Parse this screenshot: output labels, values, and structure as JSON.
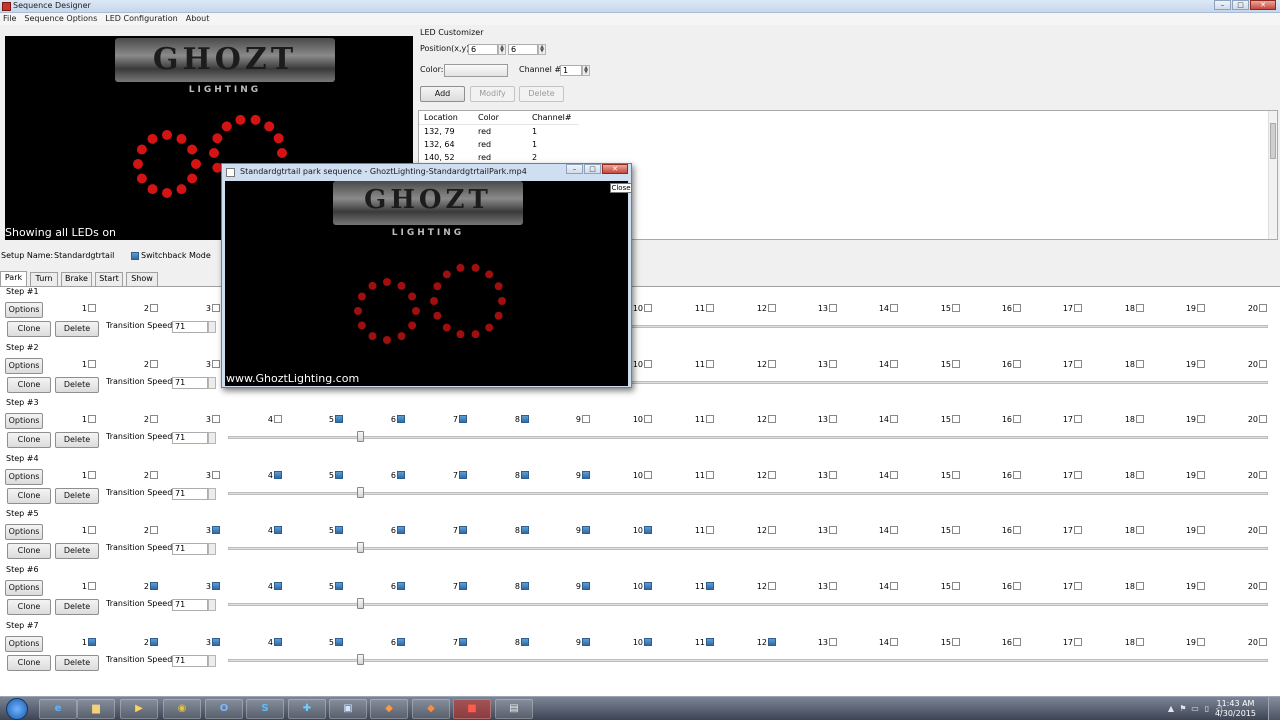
{
  "window": {
    "title": "Sequence Designer"
  },
  "menu": [
    "File",
    "Sequence Options",
    "LED Configuration",
    "About"
  ],
  "preview": {
    "logo_text": "GHOZT",
    "logo_sub": "LIGHTING",
    "status": "Showing all LEDs on"
  },
  "customizer": {
    "heading": "LED Customizer",
    "position_label": "Position(x,y):",
    "pos_x": "6",
    "pos_y": "6",
    "color_label": "Color:",
    "channel_label": "Channel #:",
    "channel": "1",
    "add": "Add",
    "modify": "Modify",
    "delete": "Delete"
  },
  "led_table": {
    "headers": [
      "Location",
      "Color",
      "Channel#"
    ],
    "rows": [
      [
        "132, 79",
        "red",
        "1"
      ],
      [
        "132, 64",
        "red",
        "1"
      ],
      [
        "140, 52",
        "red",
        "2"
      ]
    ]
  },
  "setup": {
    "name_label": "Setup Name:",
    "name_value": "Standardgtrtail",
    "switchback_label": "Switchback Mode",
    "switchback_checked": true
  },
  "tabs": [
    "Park",
    "Turn",
    "Brake",
    "Start",
    "Show"
  ],
  "step_labels": {
    "options": "Options",
    "clone": "Clone",
    "delete": "Delete",
    "transition": "Transition Speed:"
  },
  "steps": [
    {
      "title": "Step #1",
      "speed": "71",
      "on": []
    },
    {
      "title": "Step #2",
      "speed": "71",
      "on": []
    },
    {
      "title": "Step #3",
      "speed": "71",
      "on": [
        5,
        6,
        7,
        8
      ]
    },
    {
      "title": "Step #4",
      "speed": "71",
      "on": [
        4,
        5,
        6,
        7,
        8,
        9
      ]
    },
    {
      "title": "Step #5",
      "speed": "71",
      "on": [
        3,
        4,
        5,
        6,
        7,
        8,
        9,
        10
      ]
    },
    {
      "title": "Step #6",
      "speed": "71",
      "on": [
        2,
        3,
        4,
        5,
        6,
        7,
        8,
        9,
        10,
        11
      ]
    },
    {
      "title": "Step #7",
      "speed": "71",
      "on": [
        1,
        2,
        3,
        4,
        5,
        6,
        7,
        8,
        9,
        10,
        11,
        12
      ]
    }
  ],
  "led_numbers": [
    "1",
    "2",
    "3",
    "4",
    "5",
    "6",
    "7",
    "8",
    "9",
    "10",
    "11",
    "12",
    "13",
    "14",
    "15",
    "16",
    "17",
    "18",
    "19",
    "20"
  ],
  "video": {
    "title": "Standardgtrtail park sequence - GhoztLighting-StandardgtrtailPark.mp4",
    "url": "www.GhoztLighting.com",
    "tooltip": "Close"
  },
  "taskbar": {
    "time": "11:43 AM",
    "date": "4/30/2015"
  },
  "colors": {
    "led_red": "#d41414",
    "checked_blue": "#3b7fc0",
    "close_red": "#c8473a"
  }
}
